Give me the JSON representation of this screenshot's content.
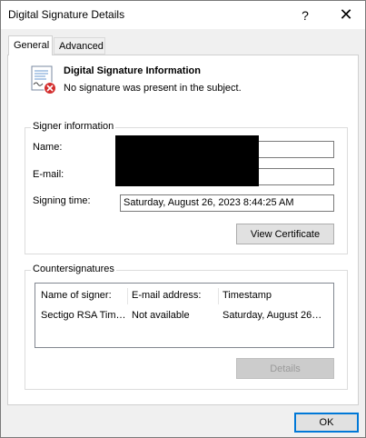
{
  "window": {
    "title": "Digital Signature Details",
    "help_glyph": "?",
    "close_glyph": "✕"
  },
  "tabs": [
    {
      "label": "General",
      "active": true
    },
    {
      "label": "Advanced",
      "active": false
    }
  ],
  "info": {
    "icon": "certificate-error-icon",
    "title": "Digital Signature Information",
    "message": "No signature was present in the subject."
  },
  "signer": {
    "group_label": "Signer information",
    "name_label": "Name:",
    "name_value": "",
    "email_label": "E-mail:",
    "email_value": "",
    "signing_time_label": "Signing time:",
    "signing_time_value": "Saturday, August 26, 2023 8:44:25 AM",
    "view_certificate_label": "View Certificate"
  },
  "countersignatures": {
    "group_label": "Countersignatures",
    "columns": [
      "Name of signer:",
      "E-mail address:",
      "Timestamp"
    ],
    "rows": [
      [
        "Sectigo RSA Tim…",
        "Not available",
        "Saturday, August 26…"
      ]
    ],
    "details_label": "Details"
  },
  "footer": {
    "ok_label": "OK"
  },
  "colors": {
    "accent": "#0078d7",
    "error": "#d32f2f"
  }
}
